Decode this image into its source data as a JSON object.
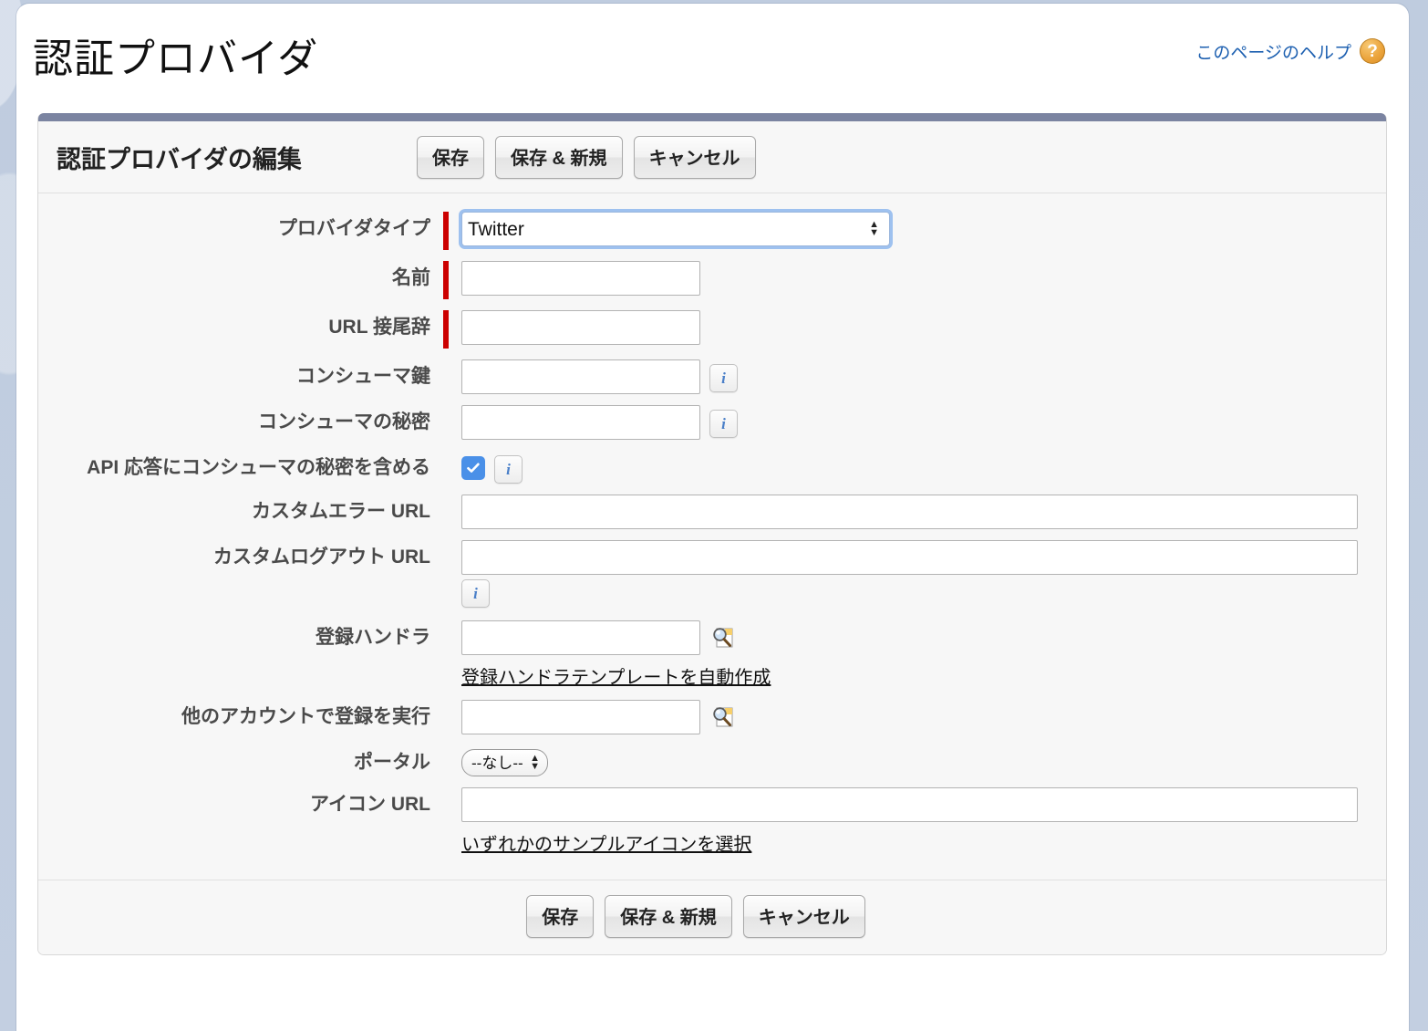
{
  "page": {
    "title": "認証プロバイダ",
    "help_link_text": "このページのヘルプ",
    "help_icon": "question-mark-icon"
  },
  "panel": {
    "heading": "認証プロバイダの編集",
    "buttons": {
      "save": "保存",
      "save_and_new": "保存 & 新規",
      "cancel": "キャンセル"
    }
  },
  "form": {
    "provider_type": {
      "label": "プロバイダタイプ",
      "value": "Twitter",
      "required": true
    },
    "name": {
      "label": "名前",
      "value": "",
      "required": true
    },
    "url_suffix": {
      "label": "URL 接尾辞",
      "value": "",
      "required": true
    },
    "consumer_key": {
      "label": "コンシューマ鍵",
      "value": "",
      "info_icon": "info-icon"
    },
    "consumer_secret": {
      "label": "コンシューマの秘密",
      "value": "",
      "info_icon": "info-icon"
    },
    "include_secret": {
      "label": "API 応答にコンシューマの秘密を含める",
      "checked": true,
      "info_icon": "info-icon"
    },
    "custom_error_url": {
      "label": "カスタムエラー URL",
      "value": ""
    },
    "custom_logout_url": {
      "label": "カスタムログアウト URL",
      "value": "",
      "info_icon": "info-icon"
    },
    "registration_handler": {
      "label": "登録ハンドラ",
      "value": "",
      "lookup_icon": "lookup-search-icon",
      "link": "登録ハンドラテンプレートを自動作成"
    },
    "execute_registration_as": {
      "label": "他のアカウントで登録を実行",
      "value": "",
      "lookup_icon": "lookup-search-icon"
    },
    "portal": {
      "label": "ポータル",
      "value": "--なし--"
    },
    "icon_url": {
      "label": "アイコン URL",
      "value": "",
      "link": "いずれかのサンプルアイコンを選択"
    }
  },
  "colors": {
    "required_marker": "#cc0000",
    "panel_topbar": "#7b84a1",
    "checkbox_accent": "#4a90e8",
    "link_blue": "#1c5fb0",
    "help_orange": "#eba43c"
  }
}
